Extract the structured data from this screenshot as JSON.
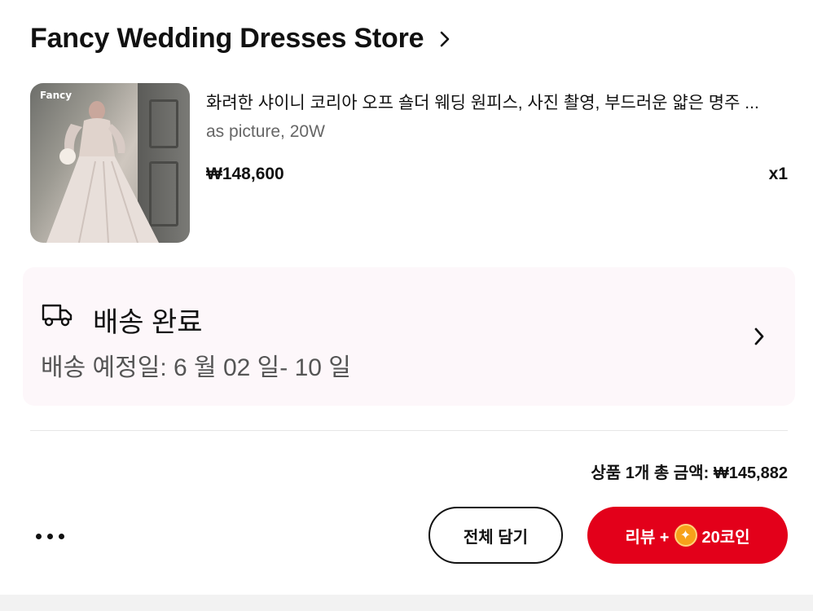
{
  "store": {
    "name": "Fancy Wedding Dresses Store"
  },
  "product": {
    "thumb_brand": "Fancy",
    "title": "화려한 샤이니 코리아 오프 숄더 웨딩 원피스, 사진 촬영, 부드러운 얇은 명주 ...",
    "option": "as picture, 20W",
    "price": "₩148,600",
    "quantity": "x1"
  },
  "shipping": {
    "status": "배송 완료",
    "eta": "배송 예정일: 6 월 02 일- 10 일"
  },
  "order": {
    "total": "상품 1개 총 금액: ₩145,882"
  },
  "actions": {
    "add_all_label": "전체 담기",
    "review_label": "리뷰 +",
    "review_coin_label": "20코인"
  },
  "colors": {
    "accent": "#e3001a",
    "shipping_bg": "#fdf7fa",
    "coin": "#f7a11a"
  }
}
